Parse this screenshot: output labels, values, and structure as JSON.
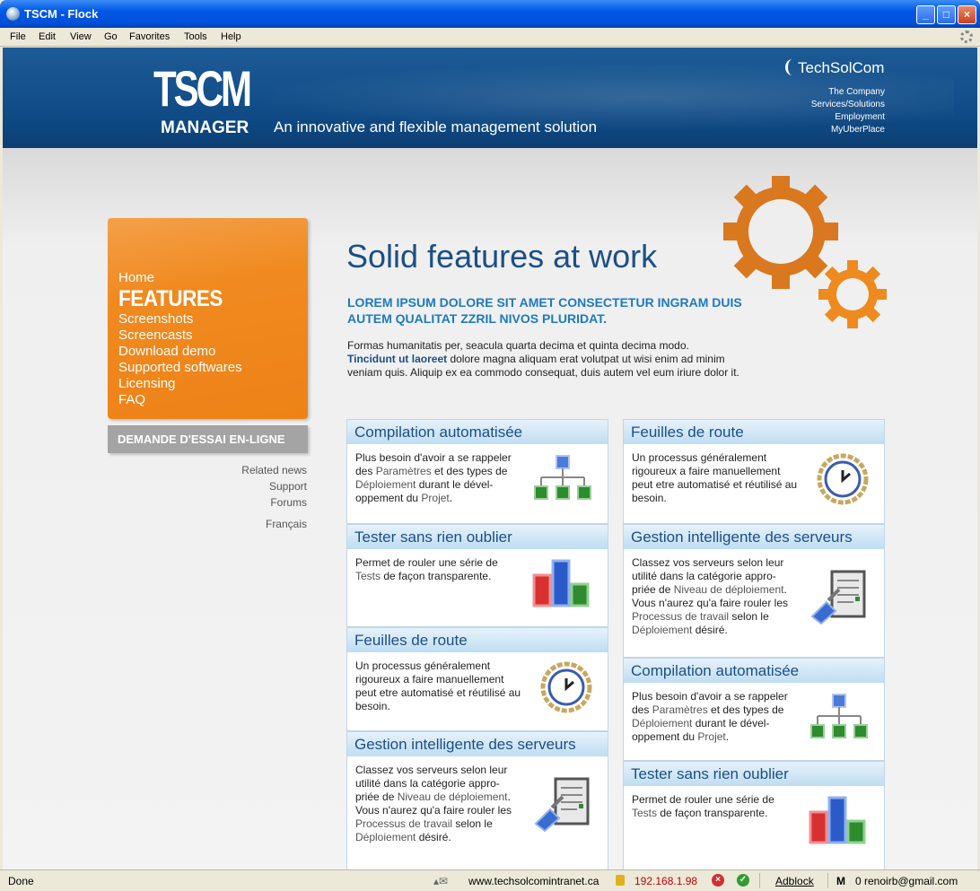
{
  "window": {
    "title": "TSCM - Flock",
    "buttons": {
      "minimize": "_",
      "maximize": "□",
      "close": "×"
    }
  },
  "menu": [
    "File",
    "Edit",
    "View",
    "Go",
    "Favorites",
    "Tools",
    "Help"
  ],
  "header": {
    "logo_main": "TSCM",
    "logo_sub": "MANAGER",
    "tagline": "An innovative and flexible management solution",
    "company": "TechSolCom",
    "nav": [
      "The Company",
      "Services/Solutions",
      "Employment",
      "MyUberPlace"
    ]
  },
  "sidebar": {
    "nav": [
      "Home",
      "FEATURES",
      "Screenshots",
      "Screencasts",
      "Download demo",
      "Supported softwares",
      "Licensing",
      "FAQ"
    ],
    "trial_button": "DEMANDE D'ESSAI EN-LIGNE",
    "links": [
      "Related news",
      "Support",
      "Forums"
    ],
    "language": "Français"
  },
  "main": {
    "title": "Solid features at work",
    "subtitle": "LOREM IPSUM DOLORE SIT AMET CONSECTETUR INGRAM DUIS AUTEM QUALITAT ZZRIL NIVOS PLURIDAT.",
    "intro_1": "Formas humanitatis per, seacula quarta decima et quinta decima modo.",
    "intro_bold": "Tincidunt ut laoreet",
    "intro_2": " dolore magna aliquam erat volutpat ut wisi enim ad minim veniam quis. Aliquip ex ea commodo consequat, duis autem vel eum iriure dolor it."
  },
  "cards": {
    "compilation": {
      "title": "Compilation automatisée",
      "t1": "Plus besoin d'avoir a se rappeler des ",
      "h1": "Paramètres",
      "t2": " et des types de ",
      "h2": "Déploiement",
      "t3": " durant le dével-oppement du ",
      "h3": "Projet",
      "t4": "."
    },
    "tester": {
      "title": "Tester sans rien oublier",
      "t1": "Permet de rouler une série de ",
      "h1": "Tests",
      "t2": " de façon transparente."
    },
    "feuilles": {
      "title": "Feuilles de route",
      "t1": "Un processus généralement rigoureux a faire manuellement peut etre automatisé et réutilisé au besoin."
    },
    "gestion": {
      "title": "Gestion intelligente des serveurs",
      "t1": "Classez vos serveurs selon leur utilité dans la catégorie appro-priée de ",
      "h1": "Niveau de déploiement",
      "t2": ". Vous n'aurez qu'a faire rouler les ",
      "h2": "Processus de travail",
      "t3": " selon le ",
      "h3": "Déploiement",
      "t4": " désiré."
    }
  },
  "status": {
    "left": "Done",
    "url": "www.techsolcomintranet.ca",
    "ip": "192.168.1.98",
    "adblock": "Adblock",
    "mail": "0 renoirb@gmail.com"
  },
  "colors": {
    "header_blue": "#0F4A85",
    "accent_orange": "#EE8217",
    "title_blue": "#1B4F86",
    "subtitle_blue": "#1C7AC0"
  }
}
